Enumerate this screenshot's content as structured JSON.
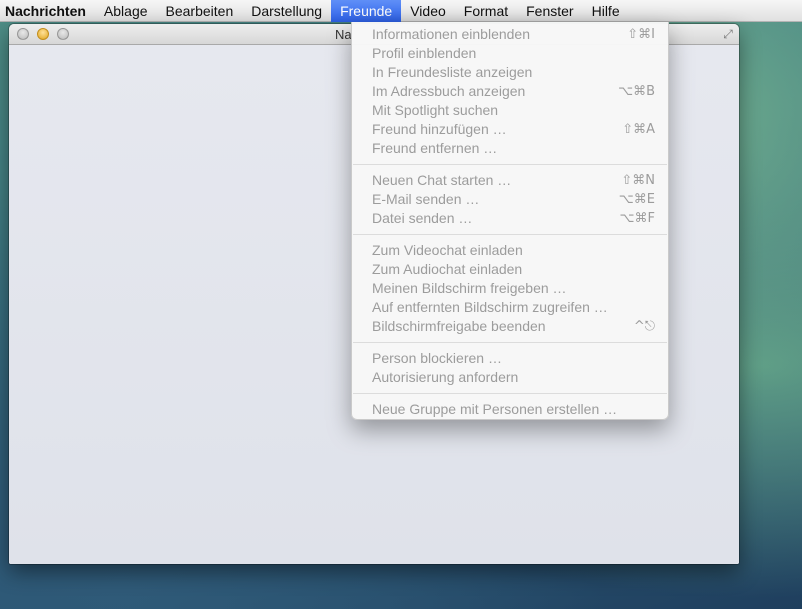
{
  "menubar": {
    "items": [
      {
        "label": "Nachrichten"
      },
      {
        "label": "Ablage"
      },
      {
        "label": "Bearbeiten"
      },
      {
        "label": "Darstellung"
      },
      {
        "label": "Freunde"
      },
      {
        "label": "Video"
      },
      {
        "label": "Format"
      },
      {
        "label": "Fenster"
      },
      {
        "label": "Hilfe"
      }
    ],
    "active": "Freunde"
  },
  "window": {
    "title": "Na"
  },
  "menu": {
    "groups": [
      [
        {
          "label": "Informationen einblenden",
          "shortcut": "⇧⌘I"
        },
        {
          "label": "Profil einblenden",
          "shortcut": ""
        },
        {
          "label": "In Freundesliste anzeigen",
          "shortcut": ""
        },
        {
          "label": "Im Adressbuch anzeigen",
          "shortcut": "⌥⌘B"
        },
        {
          "label": "Mit Spotlight suchen",
          "shortcut": ""
        },
        {
          "label": "Freund hinzufügen …",
          "shortcut": "⇧⌘A"
        },
        {
          "label": "Freund entfernen …",
          "shortcut": ""
        }
      ],
      [
        {
          "label": "Neuen Chat starten …",
          "shortcut": "⇧⌘N"
        },
        {
          "label": "E-Mail senden …",
          "shortcut": "⌥⌘E"
        },
        {
          "label": "Datei senden …",
          "shortcut": "⌥⌘F"
        }
      ],
      [
        {
          "label": "Zum Videochat einladen",
          "shortcut": ""
        },
        {
          "label": "Zum Audiochat einladen",
          "shortcut": ""
        },
        {
          "label": "Meinen Bildschirm freigeben …",
          "shortcut": ""
        },
        {
          "label": "Auf entfernten Bildschirm zugreifen …",
          "shortcut": ""
        },
        {
          "label": "Bildschirmfreigabe beenden",
          "shortcut": "^⎋"
        }
      ],
      [
        {
          "label": "Person blockieren …",
          "shortcut": ""
        },
        {
          "label": "Autorisierung anfordern",
          "shortcut": ""
        }
      ],
      [
        {
          "label": "Neue Gruppe mit Personen erstellen …",
          "shortcut": ""
        }
      ]
    ]
  },
  "colors": {
    "menu_highlight": "#3b6fee",
    "disabled_text": "#9c9c9c"
  }
}
